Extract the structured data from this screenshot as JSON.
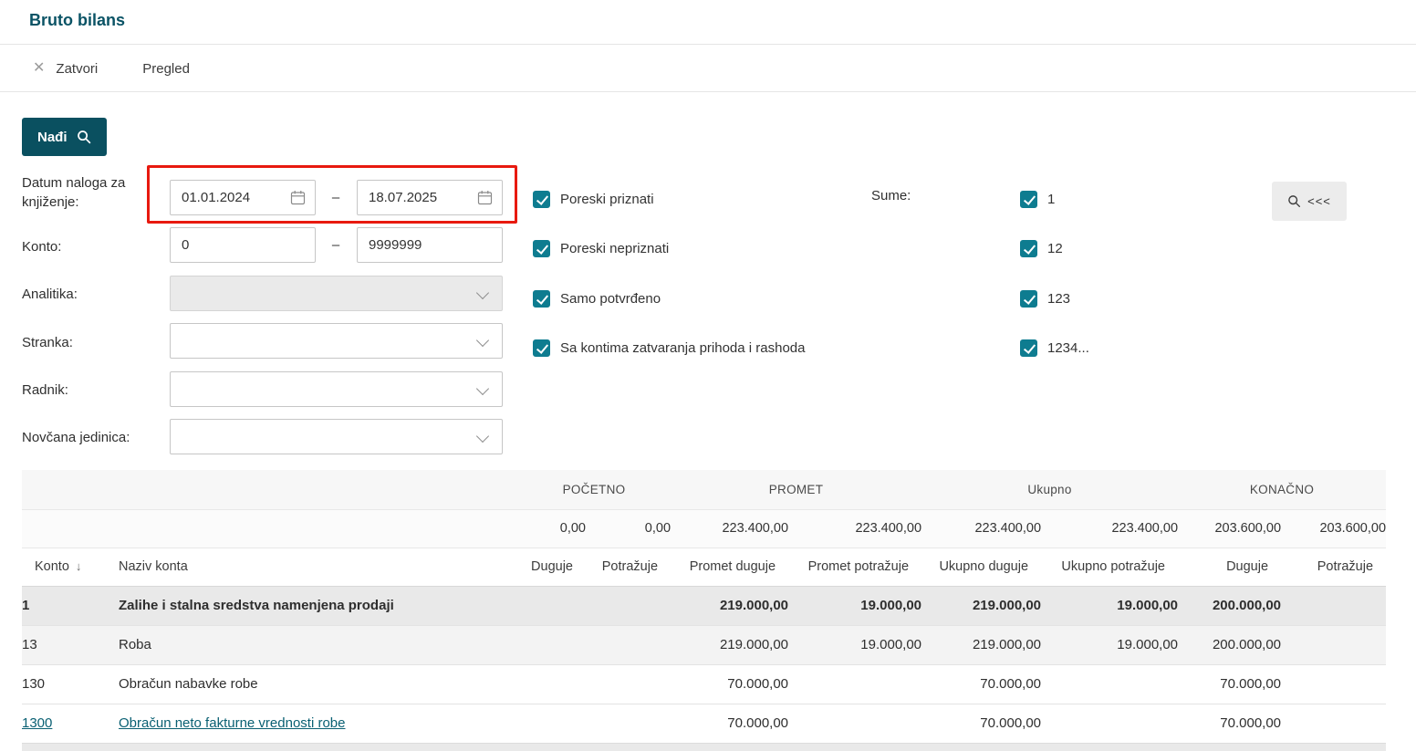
{
  "page": {
    "title": "Bruto bilans"
  },
  "toolbar": {
    "close": "Zatvori",
    "preview": "Pregled"
  },
  "filters": {
    "find": "Nađi",
    "collapse": "<<<",
    "date": {
      "label": "Datum naloga za knjiženje:",
      "from": "01.01.2024",
      "to": "18.07.2025",
      "separator": "–"
    },
    "konto": {
      "label": "Konto:",
      "from": "0",
      "to": "9999999",
      "separator": "–"
    },
    "analitika": {
      "label": "Analitika:",
      "value": "",
      "disabled": true
    },
    "stranka": {
      "label": "Stranka:",
      "value": ""
    },
    "radnik": {
      "label": "Radnik:",
      "value": ""
    },
    "novcana": {
      "label": "Novčana jedinica:",
      "value": ""
    },
    "options": [
      {
        "label": "Poreski priznati",
        "checked": true
      },
      {
        "label": "Poreski nepriznati",
        "checked": true
      },
      {
        "label": "Samo potvrđeno",
        "checked": true
      },
      {
        "label": "Sa kontima zatvaranja prihoda i rashoda",
        "checked": true
      }
    ],
    "sume": {
      "label": "Sume:",
      "options": [
        {
          "label": "1",
          "checked": true
        },
        {
          "label": "12",
          "checked": true
        },
        {
          "label": "123",
          "checked": true
        },
        {
          "label": "1234...",
          "checked": true
        }
      ]
    }
  },
  "table": {
    "groups": [
      "POČETNO",
      "PROMET",
      "Ukupno",
      "KONAČNO"
    ],
    "totals": [
      "0,00",
      "0,00",
      "223.400,00",
      "223.400,00",
      "223.400,00",
      "223.400,00",
      "203.600,00",
      "203.600,00"
    ],
    "columns": {
      "konto": "Konto",
      "naziv": "Naziv konta",
      "cols": [
        "Duguje",
        "Potražuje",
        "Promet duguje",
        "Promet potražuje",
        "Ukupno duguje",
        "Ukupno potražuje",
        "Duguje",
        "Potražuje"
      ]
    },
    "rows": [
      {
        "konto": "1",
        "naziv": "Zalihe i stalna sredstva namenjena prodaji",
        "values": [
          "",
          "",
          "219.000,00",
          "19.000,00",
          "219.000,00",
          "19.000,00",
          "200.000,00",
          ""
        ],
        "level": 1
      },
      {
        "konto": "13",
        "naziv": "Roba",
        "values": [
          "",
          "",
          "219.000,00",
          "19.000,00",
          "219.000,00",
          "19.000,00",
          "200.000,00",
          ""
        ],
        "level": 2
      },
      {
        "konto": "130",
        "naziv": "Obračun nabavke robe",
        "values": [
          "",
          "",
          "70.000,00",
          "",
          "70.000,00",
          "",
          "70.000,00",
          ""
        ],
        "level": 3
      },
      {
        "konto": "1300",
        "naziv": "Obračun neto fakturne vrednosti robe",
        "values": [
          "",
          "",
          "70.000,00",
          "",
          "70.000,00",
          "",
          "70.000,00",
          ""
        ],
        "level": 4,
        "link": true
      }
    ]
  },
  "colors": {
    "brand": "#0a5365",
    "button": "#0a5060",
    "checkbox": "#0e7c90",
    "link": "#0a6073",
    "annotation": "#e8190f"
  }
}
